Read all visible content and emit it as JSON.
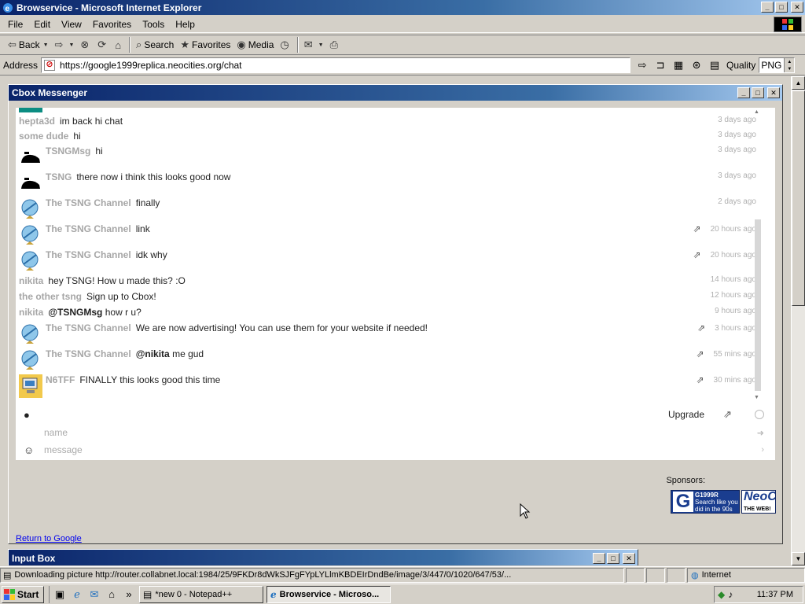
{
  "window": {
    "title": "Browservice - Microsoft Internet Explorer",
    "buttons": {
      "minimize": "_",
      "maximize": "□",
      "close": "✕"
    }
  },
  "menu": [
    "File",
    "Edit",
    "View",
    "Favorites",
    "Tools",
    "Help"
  ],
  "toolbar": {
    "back": "Back",
    "search": "Search",
    "favorites": "Favorites",
    "media": "Media"
  },
  "address": {
    "label": "Address",
    "url": "https://google1999replica.neocities.org/chat",
    "quality_label": "Quality",
    "quality_value": "PNG"
  },
  "cbox": {
    "title": "Cbox Messenger",
    "messages": [
      {
        "user": "hepta3d",
        "text": "im back hi chat",
        "time": "3 days ago",
        "avatar": "none"
      },
      {
        "user": "some dude",
        "text": "hi",
        "time": "3 days ago",
        "avatar": "none"
      },
      {
        "user": "TSNGMsg",
        "text": "hi",
        "time": "3 days ago",
        "avatar": "black-cap-icon"
      },
      {
        "user": "TSNG",
        "text": "there now i think this looks good now",
        "time": "3 days ago",
        "avatar": "black-cap-icon"
      },
      {
        "user": "The TSNG Channel",
        "text": "finally",
        "time": "2 days ago",
        "avatar": "globe-icon"
      },
      {
        "user": "The TSNG Channel",
        "text": "link",
        "time": "20 hours ago",
        "avatar": "globe-icon"
      },
      {
        "user": "The TSNG Channel",
        "text": "idk why",
        "time": "20 hours ago",
        "avatar": "globe-icon"
      },
      {
        "user": "nikita",
        "text": "hey TSNG! How u made this? :O",
        "time": "14 hours ago",
        "avatar": "none"
      },
      {
        "user": "the other tsng",
        "text": "Sign up to Cbox!",
        "time": "12 hours ago",
        "avatar": "none"
      },
      {
        "user": "nikita",
        "mention": "@TSNGMsg",
        "text": "how r u?",
        "time": "9 hours ago",
        "avatar": "none"
      },
      {
        "user": "The TSNG Channel",
        "text": "We are now advertising! You can use them for your website if needed!",
        "time": "3 hours ago",
        "avatar": "globe-icon"
      },
      {
        "user": "The TSNG Channel",
        "mention": "@nikita",
        "text": "me gud",
        "time": "55 mins ago",
        "avatar": "globe-icon"
      },
      {
        "user": "N6TFF",
        "text": "FINALLY this looks good this time",
        "time": "30 mins ago",
        "avatar": "computer-icon"
      }
    ],
    "upgrade": "Upgrade",
    "name_placeholder": "name",
    "message_placeholder": "message"
  },
  "sponsors": {
    "label": "Sponsors:",
    "google_badge_text": "G1999R",
    "google_badge_sub1": "Search like you",
    "google_badge_sub2": "did in the 90s",
    "neo_badge_text": "NeoC",
    "neo_badge_sub": "THE WEB!"
  },
  "return_link": "Return to Google",
  "inputbox": {
    "title": "Input Box"
  },
  "status": {
    "text": "Downloading picture http://router.collabnet.local:1984/25/9FKDr8dWkSJFgFYpLYLlmKBDEIrDndBe/image/3/447/0/1020/647/53/...",
    "zone": "Internet"
  },
  "taskbar": {
    "start": "Start",
    "tasks": [
      {
        "label": "*new 0 - Notepad++",
        "active": false
      },
      {
        "label": "Browservice - Microso...",
        "active": true
      }
    ],
    "clock": "11:37 PM"
  },
  "colors": {
    "title_bar": "#0a246a",
    "username_gray": "#a6a6a6",
    "accent_teal": "#0b8d82",
    "link_blue": "#0000ee"
  }
}
